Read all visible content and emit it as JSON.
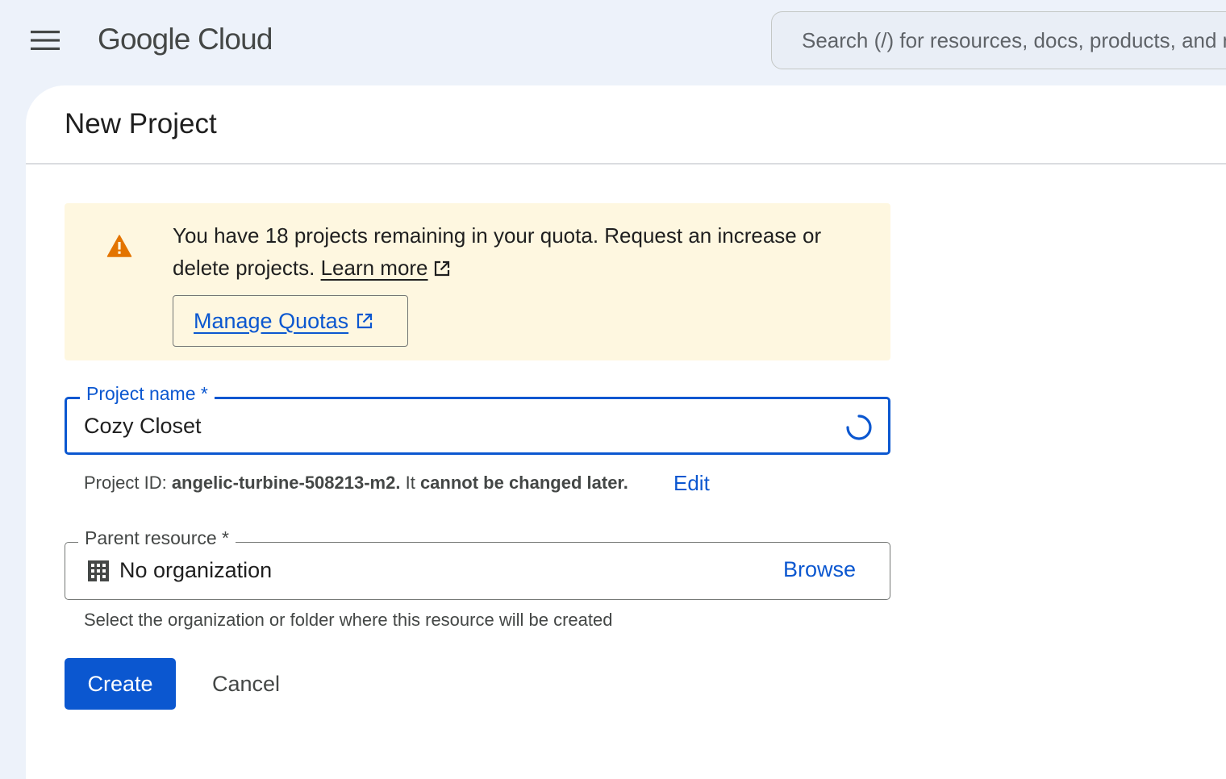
{
  "header": {
    "brand": "Google Cloud",
    "search_placeholder": "Search (/) for resources, docs, products, and more"
  },
  "page": {
    "title": "New Project"
  },
  "notice": {
    "text": "You have 18 projects remaining in your quota. Request an increase or delete projects.",
    "learn_more": "Learn more",
    "manage_quotas": "Manage Quotas",
    "icon_color": "#e37400"
  },
  "project_name": {
    "label": "Project name *",
    "value": "Cozy Closet"
  },
  "project_id": {
    "prefix": "Project ID: ",
    "id": "angelic-turbine-508213-m2.",
    "middle": " It ",
    "suffix": "cannot be changed later.",
    "edit": "Edit"
  },
  "parent_resource": {
    "label": "Parent resource *",
    "value": "No organization",
    "browse": "Browse",
    "helper": "Select the organization or folder where this resource will be created"
  },
  "actions": {
    "create": "Create",
    "cancel": "Cancel"
  },
  "colors": {
    "accent": "#0b57d0",
    "notice_bg": "#fef7e0",
    "warning": "#e37400"
  }
}
